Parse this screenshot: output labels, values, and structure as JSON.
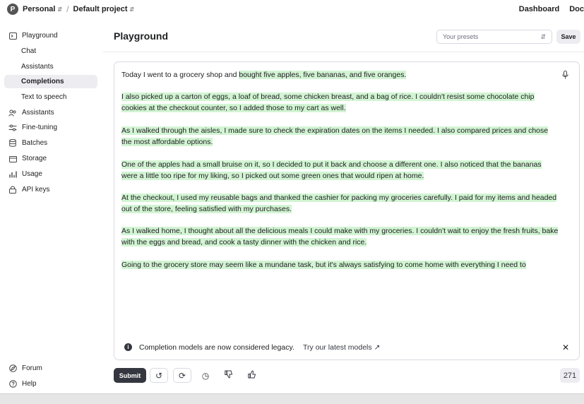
{
  "topbar": {
    "org_initial": "P",
    "org_name": "Personal",
    "project_name": "Default project",
    "links": [
      "Dashboard",
      "Doc"
    ]
  },
  "sidebar": {
    "items": [
      {
        "label": "Playground",
        "icon": "terminal-icon"
      },
      {
        "label": "Chat",
        "sub": true
      },
      {
        "label": "Assistants",
        "sub": true
      },
      {
        "label": "Completions",
        "sub": true,
        "active": true
      },
      {
        "label": "Text to speech",
        "sub": true
      },
      {
        "label": "Assistants",
        "icon": "assistants-icon"
      },
      {
        "label": "Fine-tuning",
        "icon": "tune-icon"
      },
      {
        "label": "Batches",
        "icon": "database-icon"
      },
      {
        "label": "Storage",
        "icon": "storage-icon"
      },
      {
        "label": "Usage",
        "icon": "chart-icon"
      },
      {
        "label": "API keys",
        "icon": "lock-icon"
      }
    ],
    "footer": [
      {
        "label": "Forum",
        "icon": "globe-icon"
      },
      {
        "label": "Help",
        "icon": "help-icon"
      }
    ]
  },
  "main": {
    "title": "Playground",
    "presets_placeholder": "Your presets",
    "save_label": "Save"
  },
  "editor": {
    "prompt": "Today I went to a grocery shop and ",
    "paragraphs": [
      {
        "plain": "Today I went to a grocery shop and ",
        "highlighted": "bought five apples, five bananas, and five oranges."
      },
      {
        "plain": "",
        "highlighted": "I also picked up a carton of eggs, a loaf of bread, some chicken breast, and a bag of rice. I couldn't resist some chocolate chip cookies at the checkout counter, so I added those to my cart as well."
      },
      {
        "plain": "",
        "highlighted": "As I walked through the aisles, I made sure to check the expiration dates on the items I needed. I also compared prices and chose the most affordable options."
      },
      {
        "plain": "",
        "highlighted": "One of the apples had a small bruise on it, so I decided to put it back and choose a different one. I also noticed that the bananas were a little too ripe for my liking, so I picked out some green ones that would ripen at home."
      },
      {
        "plain": "",
        "highlighted": "At the checkout, I used my reusable bags and thanked the cashier for packing my groceries carefully. I paid for my items and headed out of the store, feeling satisfied with my purchases."
      },
      {
        "plain": "",
        "highlighted": "As I walked home, I thought about all the delicious meals I could make with my groceries. I couldn't wait to enjoy the fresh fruits, bake with the eggs and bread, and cook a tasty dinner with the chicken and rice."
      },
      {
        "plain": "",
        "highlighted": "Going to the grocery store may seem like a mundane task, but it's always satisfying to come home with everything I need to"
      }
    ],
    "highlight_color": "#d2f4d3"
  },
  "notice": {
    "text": "Completion models are now considered legacy.",
    "link": "Try our latest models"
  },
  "actions": {
    "submit_label": "Submit",
    "token_count": "271"
  }
}
